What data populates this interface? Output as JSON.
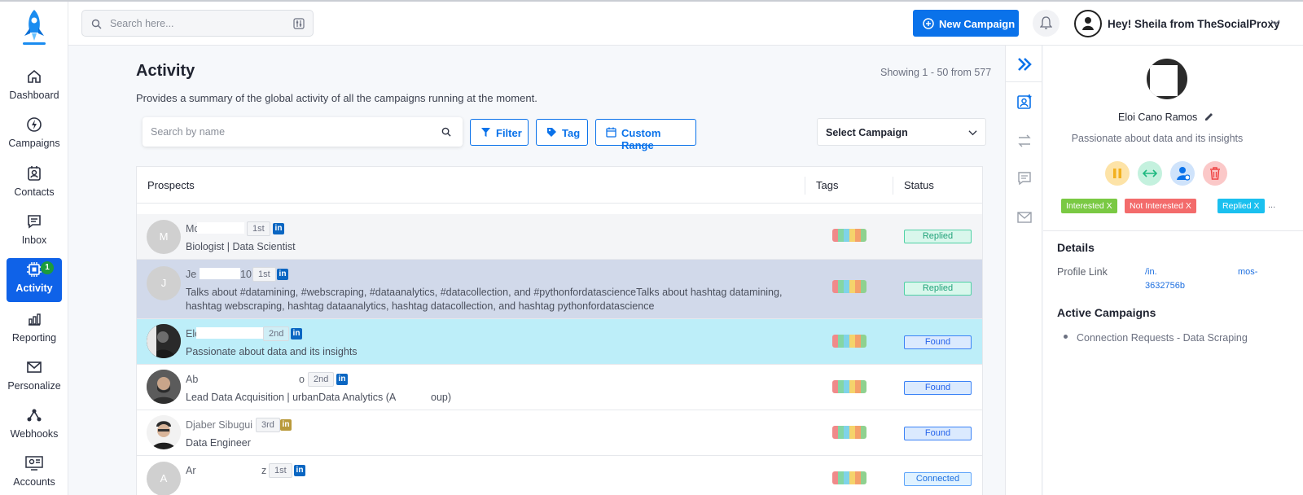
{
  "search": {
    "placeholder": "Search here..."
  },
  "header": {
    "new_campaign": "New Campaign",
    "user_greeting": "Hey! Sheila from TheSocialProxy"
  },
  "sidebar": {
    "items": [
      {
        "label": "Dashboard",
        "icon": "home-icon"
      },
      {
        "label": "Campaigns",
        "icon": "lightning-icon"
      },
      {
        "label": "Contacts",
        "icon": "contacts-icon"
      },
      {
        "label": "Inbox",
        "icon": "inbox-icon"
      },
      {
        "label": "Activity",
        "icon": "activity-icon",
        "badge": "1",
        "active": true
      },
      {
        "label": "Reporting",
        "icon": "reporting-icon"
      },
      {
        "label": "Personalize",
        "icon": "mail-icon"
      },
      {
        "label": "Webhooks",
        "icon": "webhooks-icon"
      },
      {
        "label": "Accounts",
        "icon": "accounts-icon"
      }
    ]
  },
  "main": {
    "title": "Activity",
    "showing": "Showing 1 - 50 from 577",
    "subtitle": "Provides a summary of the global activity of all the campaigns running at the moment.",
    "search_placeholder": "Search by name",
    "filter_label": "Filter",
    "tag_label": "Tag",
    "custom_range_label": "Custom Range",
    "select_campaign": "Select Campaign"
  },
  "table": {
    "columns": [
      "Prospects",
      "Tags",
      "Status"
    ],
    "rows": [
      {
        "initial": "M",
        "name": "Mc",
        "degree": "1st",
        "desc": "Biologist | Data Scientist",
        "status": "Replied"
      },
      {
        "initial": "J",
        "name": "Je",
        "name_tail": "10",
        "degree": "1st",
        "desc": "Talks about #datamining, #webscraping, #dataanalytics, #datacollection, and #pythonfordatascienceTalks about hashtag datamining, hashtag webscraping, hashtag dataanalytics, hashtag datacollection, and hashtag pythonfordatascience",
        "status": "Replied"
      },
      {
        "initial": "",
        "name": "Elo",
        "degree": "2nd",
        "desc": "Passionate about data and its insights",
        "status": "Found"
      },
      {
        "initial": "",
        "name": "Ab",
        "name_tail": "o",
        "degree": "2nd",
        "desc": "Lead Data Acquisition | urbanData Analytics (A",
        "desc_tail": "oup)",
        "status": "Found"
      },
      {
        "initial": "",
        "name": "Djaber Sibugui",
        "degree": "3rd",
        "desc": "Data Engineer",
        "status": "Found"
      },
      {
        "initial": "A",
        "name": "Ar",
        "name_tail": "z",
        "degree": "1st",
        "desc": "",
        "status": "Connected"
      }
    ],
    "tag_colors": [
      "#f08a8a",
      "#84d6a4",
      "#7fd3e8",
      "#f5d36b",
      "#f4a06b",
      "#8fd18f"
    ]
  },
  "panel": {
    "name": "Eloi Cano Ramos",
    "tagline": "Passionate about data and its insights",
    "chips": [
      {
        "label": "Interested X",
        "color": "#7ac943"
      },
      {
        "label": "Not Interested X",
        "color": "#f36b6b"
      },
      {
        "label": "Replied X",
        "color": "#1bc0ef"
      }
    ],
    "more": "...",
    "details_heading": "Details",
    "profile_link_label": "Profile Link",
    "profile_link_a": "/in.",
    "profile_link_b": "mos-",
    "profile_link_c": "3632756b",
    "active_campaigns_heading": "Active Campaigns",
    "campaign": "Connection Requests - Data Scraping"
  }
}
